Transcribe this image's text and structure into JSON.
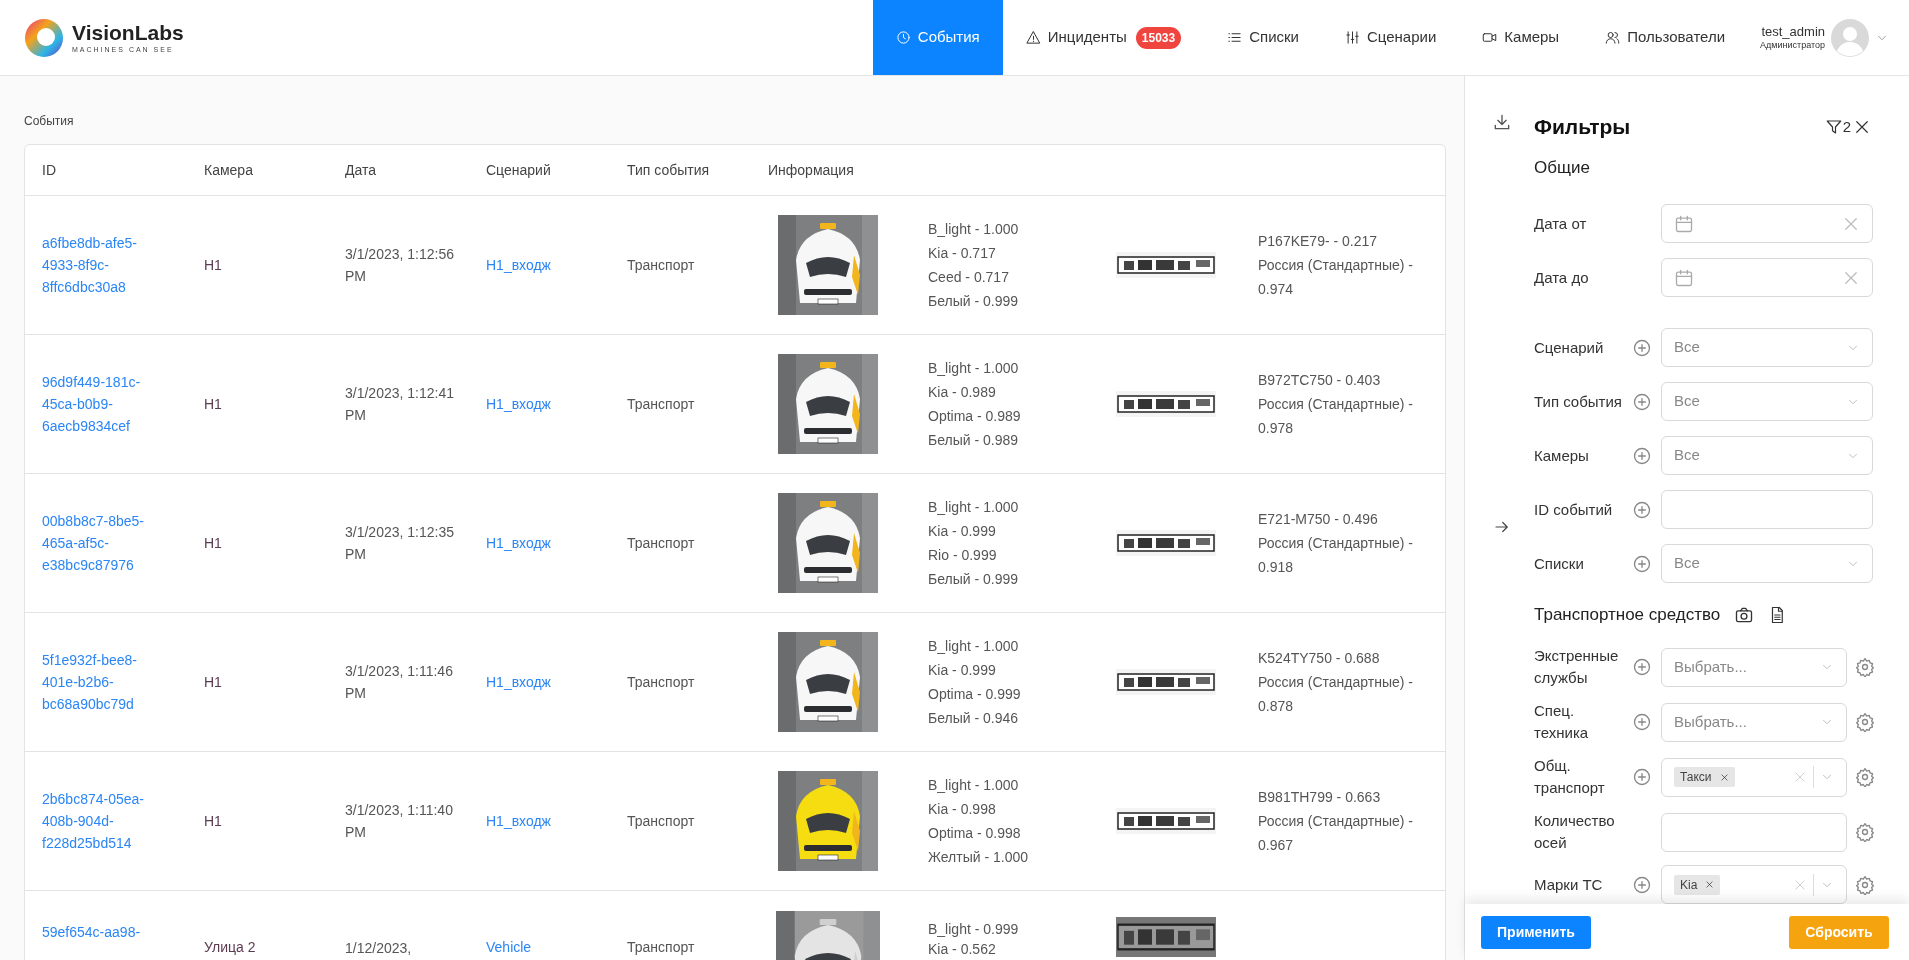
{
  "brand": {
    "name": "VisionLabs",
    "tagline": "MACHINES CAN SEE"
  },
  "nav": [
    {
      "kind": "events",
      "label": "События",
      "selected": true
    },
    {
      "kind": "incidents",
      "label": "Инциденты",
      "badge": "15033",
      "selected": false
    },
    {
      "kind": "lists",
      "label": "Списки",
      "selected": false
    },
    {
      "kind": "scenarios",
      "label": "Сценарии",
      "selected": false
    },
    {
      "kind": "cameras",
      "label": "Камеры",
      "selected": false
    },
    {
      "kind": "users",
      "label": "Пользователи",
      "selected": false
    }
  ],
  "user": {
    "name": "test_admin",
    "role": "Администратор"
  },
  "breadcrumb": "События",
  "table": {
    "columns": [
      "ID",
      "Камера",
      "Дата",
      "Сценарий",
      "Тип события",
      "Информация"
    ],
    "rows": [
      {
        "id": "a6fbe8db-afe5-4933-8f9c-8ffc6dbc30a8",
        "camera": "H1",
        "date": "3/1/2023, 1:12:56 PM",
        "scenario": "H1_входж",
        "type": "Транспорт",
        "attributes": [
          "B_light - 1.000",
          "Kia - 0.717",
          "Ceed - 0.717",
          "Белый - 0.999"
        ],
        "plate": [
          "P167KE79- - 0.217",
          "Россия (Стандартные) - 0.974"
        ]
      },
      {
        "id": "96d9f449-181c-45ca-b0b9-6aecb9834cef",
        "camera": "H1",
        "date": "3/1/2023, 1:12:41 PM",
        "scenario": "H1_входж",
        "type": "Транспорт",
        "attributes": [
          "B_light - 1.000",
          "Kia - 0.989",
          "Optima - 0.989",
          "Белый - 0.989"
        ],
        "plate": [
          "B972TC750 - 0.403",
          "Россия (Стандартные) - 0.978"
        ]
      },
      {
        "id": "00b8b8c7-8be5-465a-af5c-e38bc9c87976",
        "camera": "H1",
        "date": "3/1/2023, 1:12:35 PM",
        "scenario": "H1_входж",
        "type": "Транспорт",
        "attributes": [
          "B_light - 1.000",
          "Kia - 0.999",
          "Rio - 0.999",
          "Белый - 0.999"
        ],
        "plate": [
          "E721-M750 - 0.496",
          "Россия (Стандартные) - 0.918"
        ]
      },
      {
        "id": "5f1e932f-bee8-401e-b2b6-bc68a90bc79d",
        "camera": "H1",
        "date": "3/1/2023, 1:11:46 PM",
        "scenario": "H1_входж",
        "type": "Транспорт",
        "attributes": [
          "B_light - 1.000",
          "Kia - 0.999",
          "Optima - 0.999",
          "Белый - 0.946"
        ],
        "plate": [
          "K524TY750 - 0.688",
          "Россия (Стандартные) - 0.878"
        ]
      },
      {
        "id": "2b6bc874-05ea-408b-904d-f228d25bd514",
        "camera": "H1",
        "date": "3/1/2023, 1:11:40 PM",
        "scenario": "H1_входж",
        "type": "Транспорт",
        "attributes": [
          "B_light - 1.000",
          "Kia - 0.998",
          "Optima - 0.998",
          "Желтый - 1.000"
        ],
        "plate": [
          "B981TH799 - 0.663",
          "Россия (Стандартные) - 0.967"
        ]
      },
      {
        "id": "59ef654c-aa98-",
        "camera": "Улица 2",
        "date": "1/12/2023,",
        "scenario": "Vehicle",
        "type": "Транспорт",
        "attributes": [
          "B_light - 0.999",
          "Kia - 0.562"
        ],
        "partial": true
      }
    ]
  },
  "filters": {
    "title": "Фильтры",
    "active_count": "2",
    "apply": "Применить",
    "reset": "Сбросить",
    "sections": [
      {
        "title": "Общие",
        "rows": [
          {
            "kind": "date",
            "label": "Дата от"
          },
          {
            "kind": "date",
            "label": "Дата до"
          },
          {
            "kind": "select",
            "label": "Сценарий",
            "value": "Все",
            "add": true
          },
          {
            "kind": "select",
            "label": "Тип события",
            "value": "Все",
            "add": true
          },
          {
            "kind": "select",
            "label": "Камеры",
            "value": "Все",
            "add": true
          },
          {
            "kind": "text",
            "label": "ID событий",
            "add": true
          },
          {
            "kind": "select",
            "label": "Списки",
            "value": "Все",
            "add": true
          }
        ]
      },
      {
        "title": "Транспортное средство",
        "icons": true,
        "rows": [
          {
            "kind": "select",
            "label": "Экстренные службы",
            "placeholder": "Выбрать...",
            "add": true,
            "settings": true
          },
          {
            "kind": "select",
            "label": "Спец. техника",
            "placeholder": "Выбрать...",
            "add": true,
            "settings": true
          },
          {
            "kind": "tags",
            "label": "Общ. транспорт",
            "tags": [
              "Такси"
            ],
            "add": true,
            "settings": true
          },
          {
            "kind": "text",
            "label": "Количество осей",
            "add": false,
            "settings": true
          },
          {
            "kind": "tags",
            "label": "Марки ТС",
            "tags": [
              "Kia"
            ],
            "add": true,
            "settings": true
          }
        ]
      }
    ]
  }
}
